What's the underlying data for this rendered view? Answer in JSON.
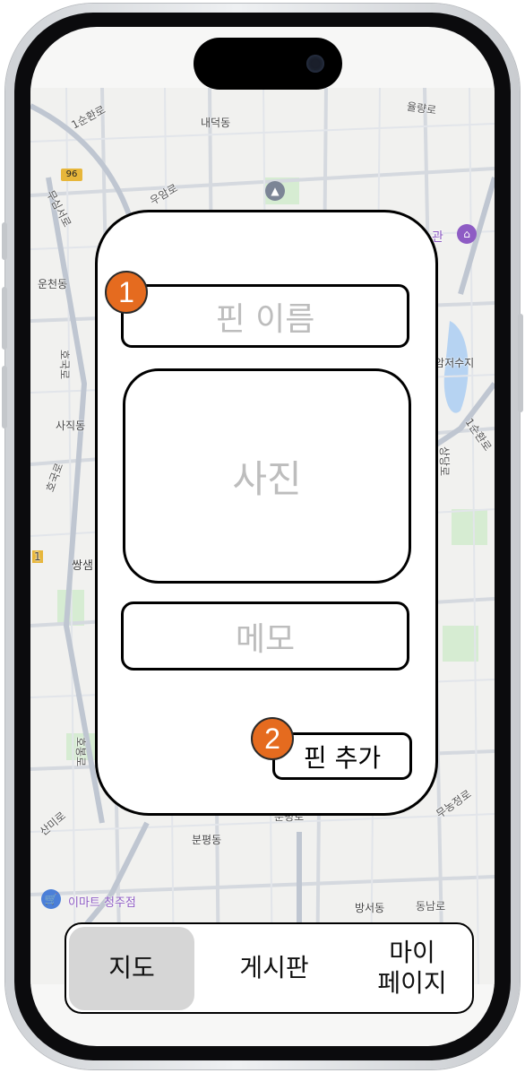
{
  "map": {
    "labels": {
      "road_1": "1순환로",
      "district_naedeok": "내덕동",
      "road_yulryang": "율량로",
      "route_no": "96",
      "road_muxim": "무심서로",
      "road_uam": "우암로",
      "poi_museum": "관",
      "district_uncheon": "운천동",
      "reservoir": "명암저수지",
      "road_hoguk": "호국로",
      "district_sajik": "사직동",
      "road_hoguk2": "호국로",
      "road_1_east": "1순환로",
      "road_sangdang": "상당로",
      "district_ssangsaem": "쌍샘",
      "road_ho": "호봉로",
      "road_sanmi": "산미로",
      "road_bunpyeong": "분평로",
      "district_bunpyeong": "분평동",
      "road_mudong": "무농정로",
      "poi_emart": "이마트 청주점",
      "district_bangseo": "방서동",
      "road_dongnam": "동남로",
      "small_1": "1"
    },
    "colors": {
      "road": "#d5d9df",
      "main_road": "#bfc6d1",
      "green": "#d6ecd2",
      "water": "#b6d3f2",
      "poi_purple": "#8e5cc4",
      "poi_blue": "#4b7fd8",
      "poi_gray": "#7c8596"
    }
  },
  "modal": {
    "pin_name_placeholder": "핀 이름",
    "photo_label": "사진",
    "memo_placeholder": "메모",
    "add_button_label": "핀 추가",
    "badge_1": "1",
    "badge_2": "2"
  },
  "tabbar": {
    "tab_map": "지도",
    "tab_board": "게시판",
    "tab_mypage_line1": "마이",
    "tab_mypage_line2": "페이지",
    "active_color": "#d6d6d6"
  }
}
